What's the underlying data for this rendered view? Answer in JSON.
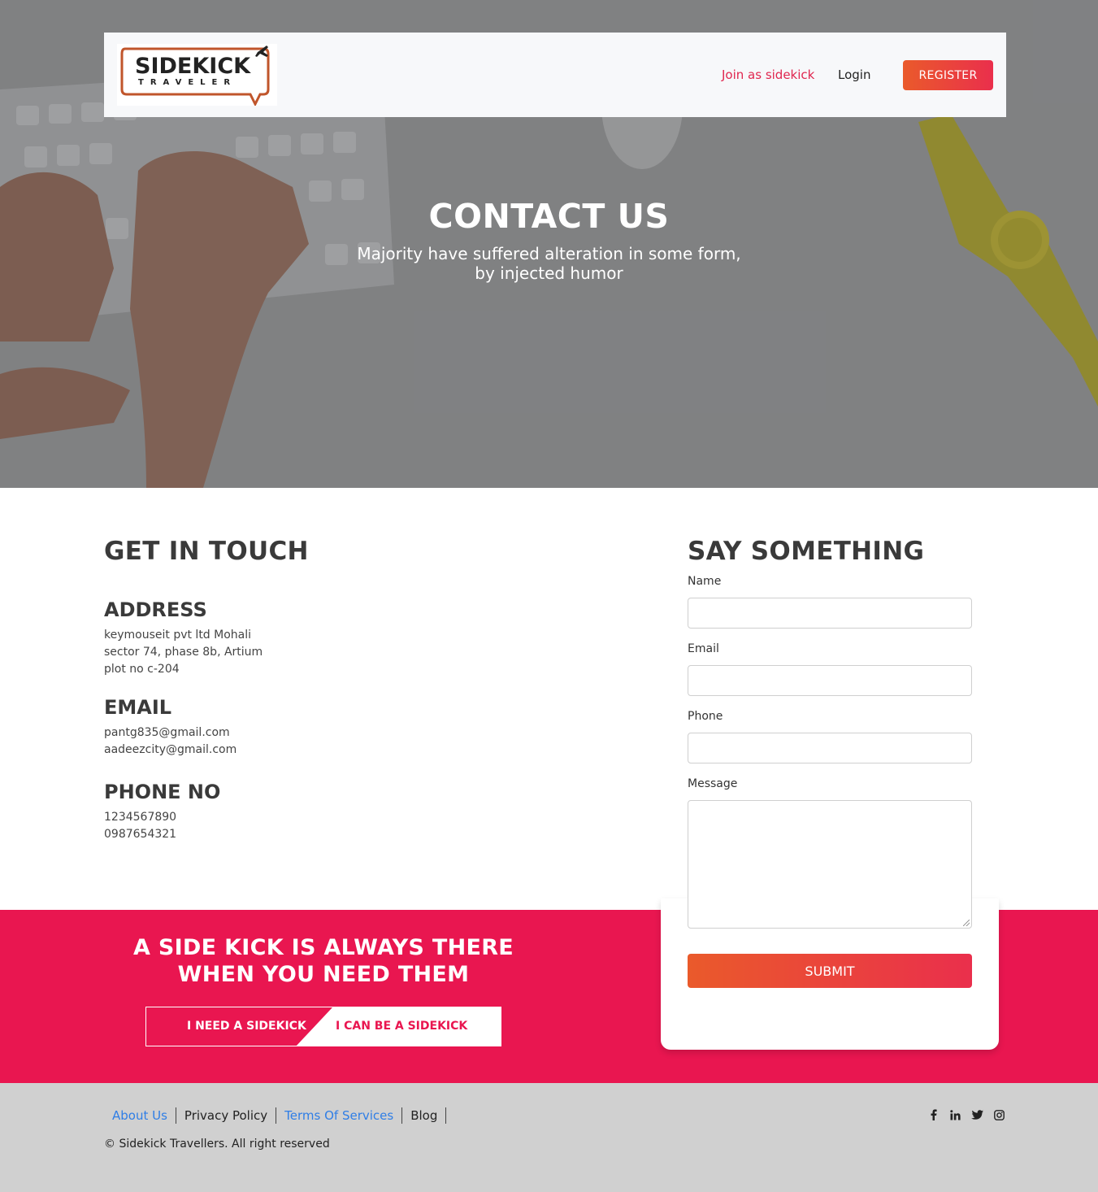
{
  "nav": {
    "logo_word": "SIDEKICK",
    "logo_sub": "TRAVELER",
    "join_label": "Join as sidekick",
    "login_label": "Login",
    "register_label": "REGISTER"
  },
  "hero": {
    "title": "CONTACT US",
    "subtitle_line1": "Majority have suffered alteration in some form,",
    "subtitle_line2": "by injected humor"
  },
  "contact": {
    "heading": "GET IN TOUCH",
    "address_heading": "ADDRESS",
    "address_lines": [
      "keymouseit pvt ltd Mohali",
      "sector 74, phase 8b, Artium",
      "plot no c-204"
    ],
    "email_heading": "EMAIL",
    "emails": [
      "pantg835@gmail.com",
      "aadeezcity@gmail.com"
    ],
    "phone_heading": "PHONE NO",
    "phones": [
      "1234567890",
      "0987654321"
    ]
  },
  "form": {
    "heading": "SAY SOMETHING",
    "name_label": "Name",
    "email_label": "Email",
    "phone_label": "Phone",
    "message_label": "Message",
    "name_value": "",
    "email_value": "",
    "phone_value": "",
    "message_value": "",
    "submit_label": "SUBMIT"
  },
  "band": {
    "title_line1": "A SIDE KICK IS ALWAYS THERE",
    "title_line2": "WHEN YOU NEED THEM",
    "need_label": "I NEED A SIDEKICK",
    "be_label": "I CAN BE A SIDEKICK"
  },
  "footer": {
    "links": [
      "About Us",
      "Privacy Policy",
      "Terms Of Services",
      "Blog"
    ],
    "copyright": "© Sidekick Travellers. All right reserved",
    "socials": [
      "facebook-icon",
      "linkedin-icon",
      "twitter-icon",
      "instagram-icon"
    ]
  },
  "colors": {
    "accent": "#e91650",
    "button_start": "#ea5a2b",
    "button_end": "#ea2f4c",
    "link_blue": "#2f7ee6",
    "footer_bg": "#d0d0d0"
  }
}
